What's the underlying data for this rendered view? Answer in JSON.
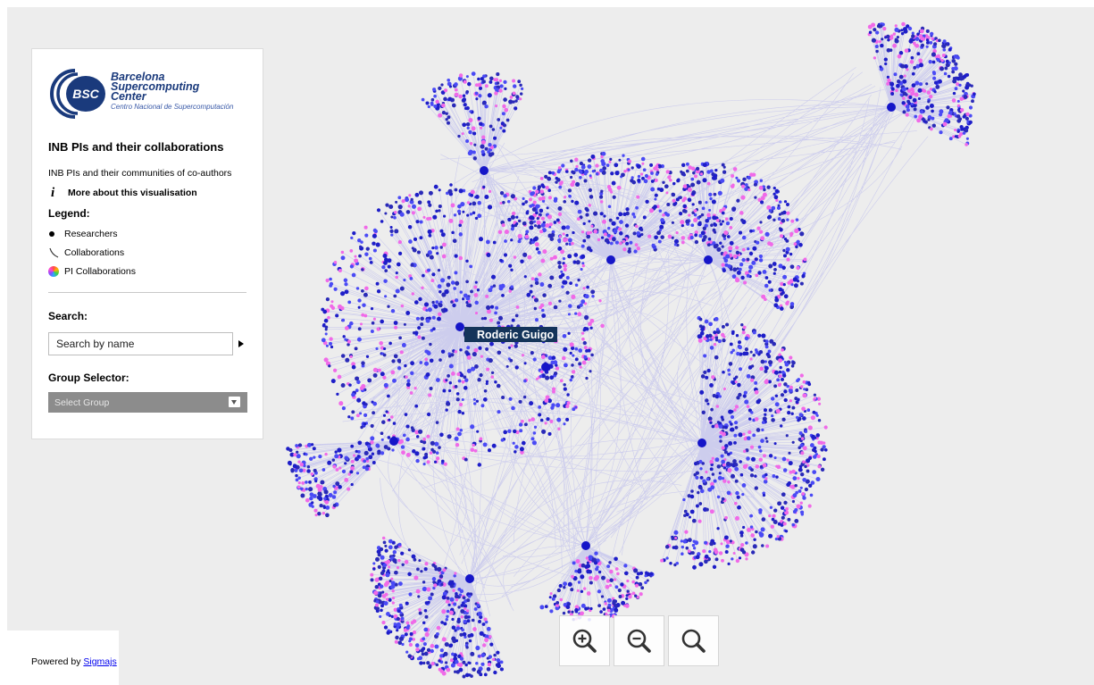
{
  "logo": {
    "badge": "BSC",
    "line1": "Barcelona",
    "line2": "Supercomputing",
    "line3": "Center",
    "sub": "Centro Nacional de Supercomputación"
  },
  "panel": {
    "title": "INB PIs and their collaborations",
    "subtitle": "INB PIs and their communities of co-authors",
    "info_icon": "i",
    "info_label": "More about this visualisation"
  },
  "legend": {
    "title": "Legend:",
    "items": [
      {
        "icon": "researcher-dot-icon",
        "label": "Researchers"
      },
      {
        "icon": "collaboration-curve-icon",
        "label": "Collaborations"
      },
      {
        "icon": "pi-collaboration-color-icon",
        "label": "PI Collaborations"
      }
    ]
  },
  "search": {
    "title": "Search:",
    "placeholder": "Search by name",
    "go_icon": "play-arrow-icon"
  },
  "group": {
    "title": "Group Selector:",
    "selected": "Select Group"
  },
  "graph": {
    "highlighted_node": "Roderic Guigo",
    "edge_color": "#3b3bf0",
    "node_colors": [
      "#1e1ec8",
      "#4a4af5",
      "#f06ae8",
      "#2a2ab8"
    ]
  },
  "zoom": {
    "in_icon": "zoom-in-icon",
    "out_icon": "zoom-out-icon",
    "reset_icon": "zoom-reset-icon"
  },
  "footer": {
    "prefix": "Powered by ",
    "link": "Sigmajs"
  }
}
